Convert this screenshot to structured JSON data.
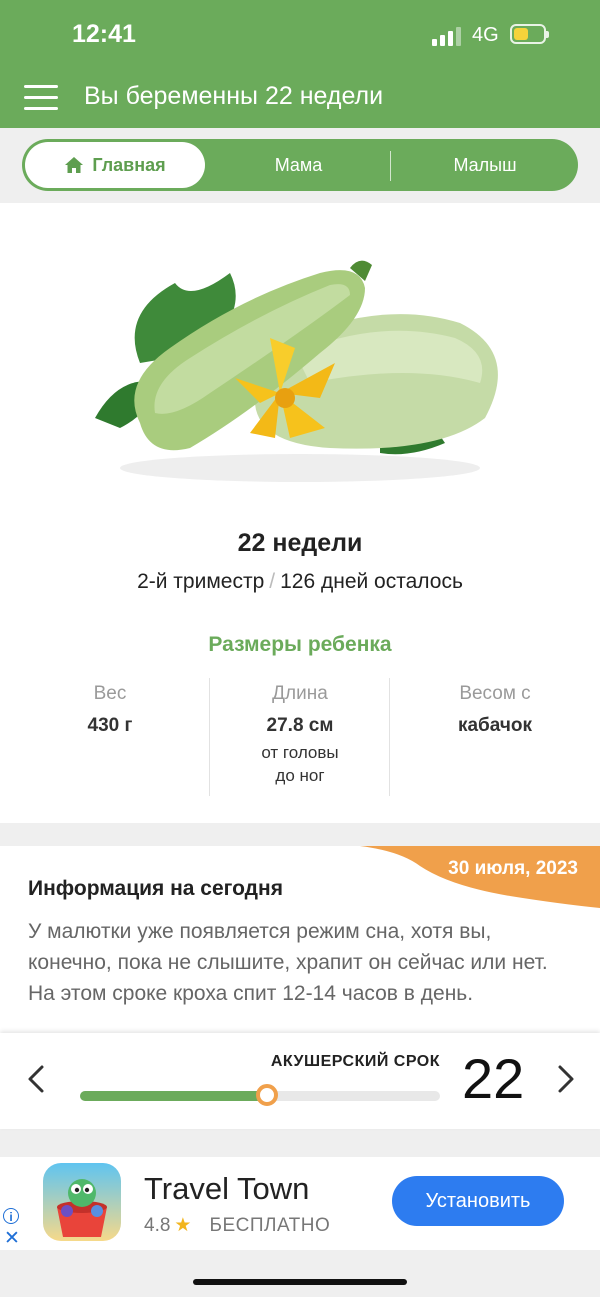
{
  "status": {
    "time": "12:41",
    "network": "4G"
  },
  "header": {
    "title": "Вы беременны 22 недели"
  },
  "tabs": [
    {
      "label": "Главная"
    },
    {
      "label": "Мама"
    },
    {
      "label": "Малыш"
    }
  ],
  "week": {
    "title": "22 недели",
    "trimester": "2-й триместр",
    "separator": "/",
    "remaining": "126 дней осталось"
  },
  "sizes": {
    "title": "Размеры ребенка",
    "weight": {
      "label": "Вес",
      "value": "430 г"
    },
    "length": {
      "label": "Длина",
      "value": "27.8 см",
      "note_line1": "от головы",
      "note_line2": "до ног"
    },
    "compare": {
      "label": "Весом с",
      "value": "кабачок"
    }
  },
  "info": {
    "date": "30 июля, 2023",
    "title": "Информация на сегодня",
    "text": "У малютки уже появляется режим сна, хотя вы, конечно, пока не слышите, храпит он сейчас или нет. На этом сроке кроха спит 12-14 часов в день."
  },
  "term": {
    "label": "АКУШЕРСКИЙ СРОК",
    "week": "22",
    "progress": 0.52
  },
  "ad": {
    "name": "Travel Town",
    "rating": "4.8",
    "price": "БЕСПЛАТНО",
    "button": "Установить"
  },
  "colors": {
    "primary_green": "#6bab5b",
    "accent_orange": "#f0a04b",
    "ad_blue": "#2d7cf0"
  }
}
